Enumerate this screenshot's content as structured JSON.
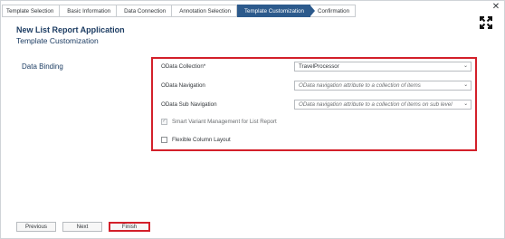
{
  "wizard": {
    "steps": [
      {
        "label": "Template Selection"
      },
      {
        "label": "Basic Information"
      },
      {
        "label": "Data Connection"
      },
      {
        "label": "Annotation Selection"
      },
      {
        "label": "Template Customization"
      },
      {
        "label": "Confirmation"
      }
    ],
    "active_step": 4
  },
  "header": {
    "app_title": "New List Report Application",
    "page_title": "Template Customization"
  },
  "data_binding": {
    "section_label": "Data Binding",
    "odata_collection": {
      "label": "OData Collection*",
      "value": "TravelProcessor"
    },
    "odata_navigation": {
      "label": "OData Navigation",
      "placeholder": "OData navigation attribute to a collection of items"
    },
    "odata_sub_navigation": {
      "label": "OData Sub Navigation",
      "placeholder": "OData navigation attribute to a collection of items on sub level"
    },
    "smart_variant": {
      "label": "Smart Variant Management for List Report",
      "checked": true,
      "disabled": true
    },
    "flexible_column": {
      "label": "Flexible Column Layout",
      "checked": false,
      "disabled": false
    },
    "highlight_color": "#d3202a"
  },
  "footer": {
    "previous_label": "Previous",
    "next_label": "Next",
    "finish_label": "Finish"
  },
  "icons": {
    "close": "close-icon",
    "expand": "full-screen-icon",
    "check": "✓",
    "chevron": "chevron-down-icon"
  },
  "colors": {
    "active_step": "#2c5a8c",
    "title": "#1d3d63",
    "highlight": "#d3202a"
  }
}
